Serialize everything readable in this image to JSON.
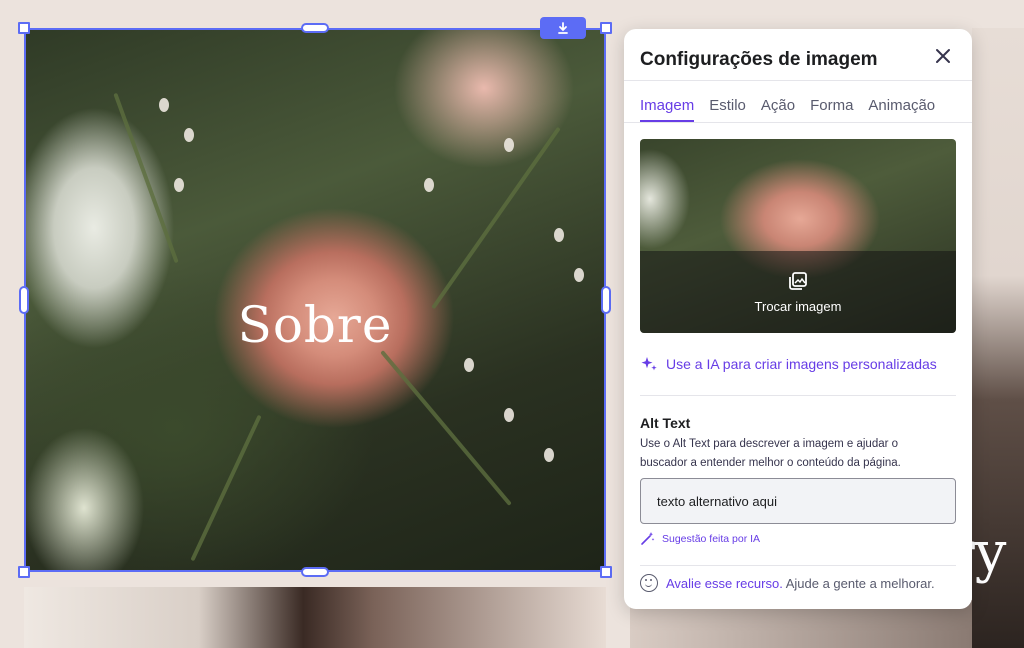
{
  "canvas": {
    "heading_text": "Sobre",
    "right_partial_text": "ry"
  },
  "selection": {
    "download_icon": "download-icon"
  },
  "panel": {
    "title": "Configurações de imagem",
    "close_icon": "close-icon",
    "tabs": [
      {
        "label": "Imagem",
        "active": true
      },
      {
        "label": "Estilo",
        "active": false
      },
      {
        "label": "Ação",
        "active": false
      },
      {
        "label": "Forma",
        "active": false
      },
      {
        "label": "Animação",
        "active": false
      }
    ],
    "preview": {
      "swap_label": "Trocar imagem",
      "swap_icon": "image-swap-icon"
    },
    "ai_link": {
      "icon": "sparkle-icon",
      "label": "Use a IA para criar imagens personalizadas"
    },
    "alt_text": {
      "title": "Alt Text",
      "description": "Use o Alt Text para descrever a imagem e ajudar o buscador a entender melhor o conteúdo da página.",
      "value": "texto alternativo aqui",
      "suggestion_icon": "magic-wand-icon",
      "suggestion_label": "Sugestão feita por IA"
    },
    "feedback": {
      "icon": "smile-icon",
      "link_label": "Avalie esse recurso.",
      "text": "Ajude a gente a melhorar."
    }
  },
  "colors": {
    "accent": "#673de6",
    "selection": "#5c6cf5",
    "background": "#ece3dd"
  }
}
